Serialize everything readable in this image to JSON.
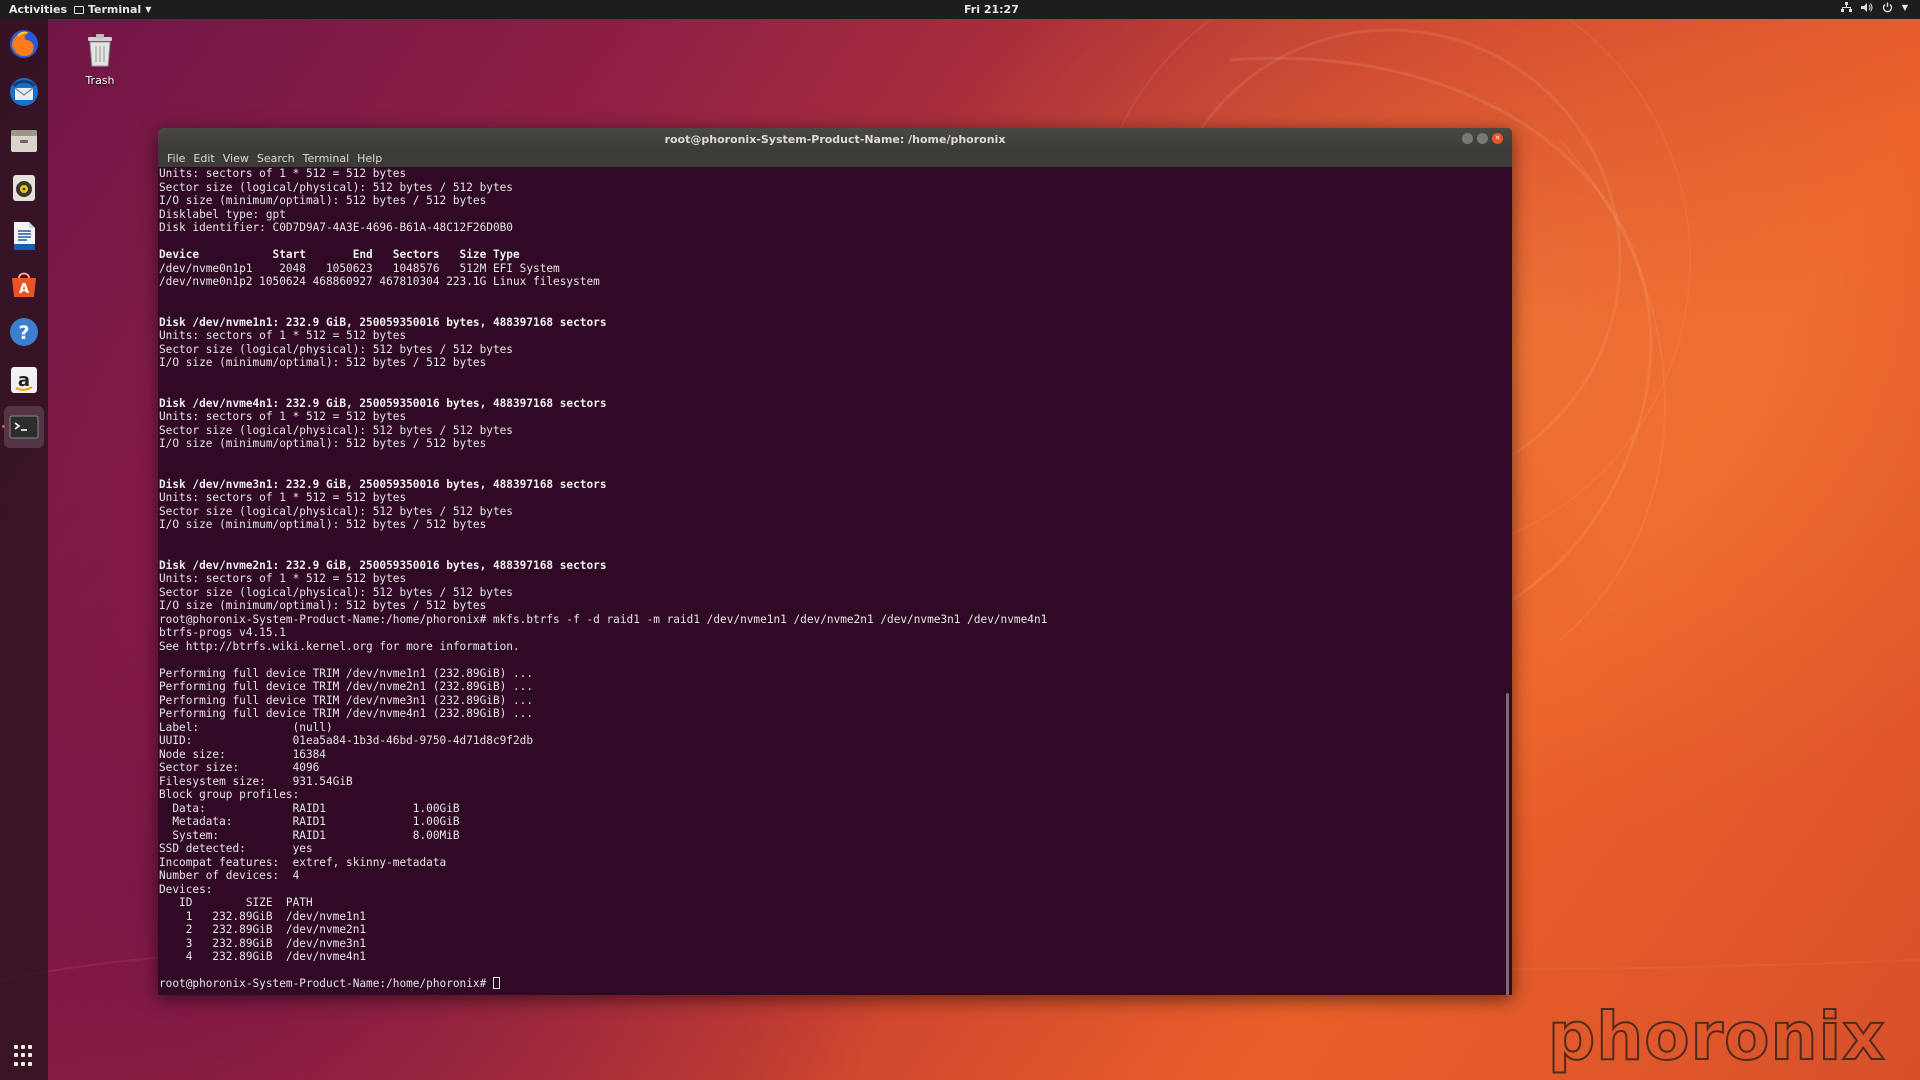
{
  "topbar": {
    "activities": "Activities",
    "app_menu": "Terminal",
    "clock": "Fri 21:27"
  },
  "desktop": {
    "trash_label": "Trash"
  },
  "window": {
    "title": "root@phoronix-System-Product-Name: /home/phoronix",
    "menu": [
      "File",
      "Edit",
      "View",
      "Search",
      "Terminal",
      "Help"
    ]
  },
  "terminal": {
    "lines": [
      {
        "t": "Units: sectors of 1 * 512 = 512 bytes",
        "b": false
      },
      {
        "t": "Sector size (logical/physical): 512 bytes / 512 bytes",
        "b": false
      },
      {
        "t": "I/O size (minimum/optimal): 512 bytes / 512 bytes",
        "b": false
      },
      {
        "t": "Disklabel type: gpt",
        "b": false
      },
      {
        "t": "Disk identifier: C0D7D9A7-4A3E-4696-B61A-48C12F26D0B0",
        "b": false
      },
      {
        "t": "",
        "b": false
      },
      {
        "t": "Device           Start       End   Sectors   Size Type",
        "b": true
      },
      {
        "t": "/dev/nvme0n1p1    2048   1050623   1048576   512M EFI System",
        "b": false
      },
      {
        "t": "/dev/nvme0n1p2 1050624 468860927 467810304 223.1G Linux filesystem",
        "b": false
      },
      {
        "t": "",
        "b": false
      },
      {
        "t": "",
        "b": false
      },
      {
        "t": "Disk /dev/nvme1n1: 232.9 GiB, 250059350016 bytes, 488397168 sectors",
        "b": true
      },
      {
        "t": "Units: sectors of 1 * 512 = 512 bytes",
        "b": false
      },
      {
        "t": "Sector size (logical/physical): 512 bytes / 512 bytes",
        "b": false
      },
      {
        "t": "I/O size (minimum/optimal): 512 bytes / 512 bytes",
        "b": false
      },
      {
        "t": "",
        "b": false
      },
      {
        "t": "",
        "b": false
      },
      {
        "t": "Disk /dev/nvme4n1: 232.9 GiB, 250059350016 bytes, 488397168 sectors",
        "b": true
      },
      {
        "t": "Units: sectors of 1 * 512 = 512 bytes",
        "b": false
      },
      {
        "t": "Sector size (logical/physical): 512 bytes / 512 bytes",
        "b": false
      },
      {
        "t": "I/O size (minimum/optimal): 512 bytes / 512 bytes",
        "b": false
      },
      {
        "t": "",
        "b": false
      },
      {
        "t": "",
        "b": false
      },
      {
        "t": "Disk /dev/nvme3n1: 232.9 GiB, 250059350016 bytes, 488397168 sectors",
        "b": true
      },
      {
        "t": "Units: sectors of 1 * 512 = 512 bytes",
        "b": false
      },
      {
        "t": "Sector size (logical/physical): 512 bytes / 512 bytes",
        "b": false
      },
      {
        "t": "I/O size (minimum/optimal): 512 bytes / 512 bytes",
        "b": false
      },
      {
        "t": "",
        "b": false
      },
      {
        "t": "",
        "b": false
      },
      {
        "t": "Disk /dev/nvme2n1: 232.9 GiB, 250059350016 bytes, 488397168 sectors",
        "b": true
      },
      {
        "t": "Units: sectors of 1 * 512 = 512 bytes",
        "b": false
      },
      {
        "t": "Sector size (logical/physical): 512 bytes / 512 bytes",
        "b": false
      },
      {
        "t": "I/O size (minimum/optimal): 512 bytes / 512 bytes",
        "b": false
      },
      {
        "t": "root@phoronix-System-Product-Name:/home/phoronix# mkfs.btrfs -f -d raid1 -m raid1 /dev/nvme1n1 /dev/nvme2n1 /dev/nvme3n1 /dev/nvme4n1",
        "b": false
      },
      {
        "t": "btrfs-progs v4.15.1",
        "b": false
      },
      {
        "t": "See http://btrfs.wiki.kernel.org for more information.",
        "b": false
      },
      {
        "t": "",
        "b": false
      },
      {
        "t": "Performing full device TRIM /dev/nvme1n1 (232.89GiB) ...",
        "b": false
      },
      {
        "t": "Performing full device TRIM /dev/nvme2n1 (232.89GiB) ...",
        "b": false
      },
      {
        "t": "Performing full device TRIM /dev/nvme3n1 (232.89GiB) ...",
        "b": false
      },
      {
        "t": "Performing full device TRIM /dev/nvme4n1 (232.89GiB) ...",
        "b": false
      },
      {
        "t": "Label:              (null)",
        "b": false
      },
      {
        "t": "UUID:               01ea5a84-1b3d-46bd-9750-4d71d8c9f2db",
        "b": false
      },
      {
        "t": "Node size:          16384",
        "b": false
      },
      {
        "t": "Sector size:        4096",
        "b": false
      },
      {
        "t": "Filesystem size:    931.54GiB",
        "b": false
      },
      {
        "t": "Block group profiles:",
        "b": false
      },
      {
        "t": "  Data:             RAID1             1.00GiB",
        "b": false
      },
      {
        "t": "  Metadata:         RAID1             1.00GiB",
        "b": false
      },
      {
        "t": "  System:           RAID1             8.00MiB",
        "b": false
      },
      {
        "t": "SSD detected:       yes",
        "b": false
      },
      {
        "t": "Incompat features:  extref, skinny-metadata",
        "b": false
      },
      {
        "t": "Number of devices:  4",
        "b": false
      },
      {
        "t": "Devices:",
        "b": false
      },
      {
        "t": "   ID        SIZE  PATH",
        "b": false
      },
      {
        "t": "    1   232.89GiB  /dev/nvme1n1",
        "b": false
      },
      {
        "t": "    2   232.89GiB  /dev/nvme2n1",
        "b": false
      },
      {
        "t": "    3   232.89GiB  /dev/nvme3n1",
        "b": false
      },
      {
        "t": "    4   232.89GiB  /dev/nvme4n1",
        "b": false
      },
      {
        "t": "",
        "b": false
      }
    ],
    "prompt": "root@phoronix-System-Product-Name:/home/phoronix# "
  },
  "watermark": "phoronix",
  "dock": {
    "items": [
      "firefox-icon",
      "thunderbird-icon",
      "files-icon",
      "rhythmbox-icon",
      "libreoffice-writer-icon",
      "software-center-icon",
      "help-icon",
      "amazon-icon",
      "terminal-icon"
    ]
  },
  "colors": {
    "terminal_bg": "#300a24",
    "accent": "#e95420",
    "topbar_bg": "#1d1d1d"
  }
}
